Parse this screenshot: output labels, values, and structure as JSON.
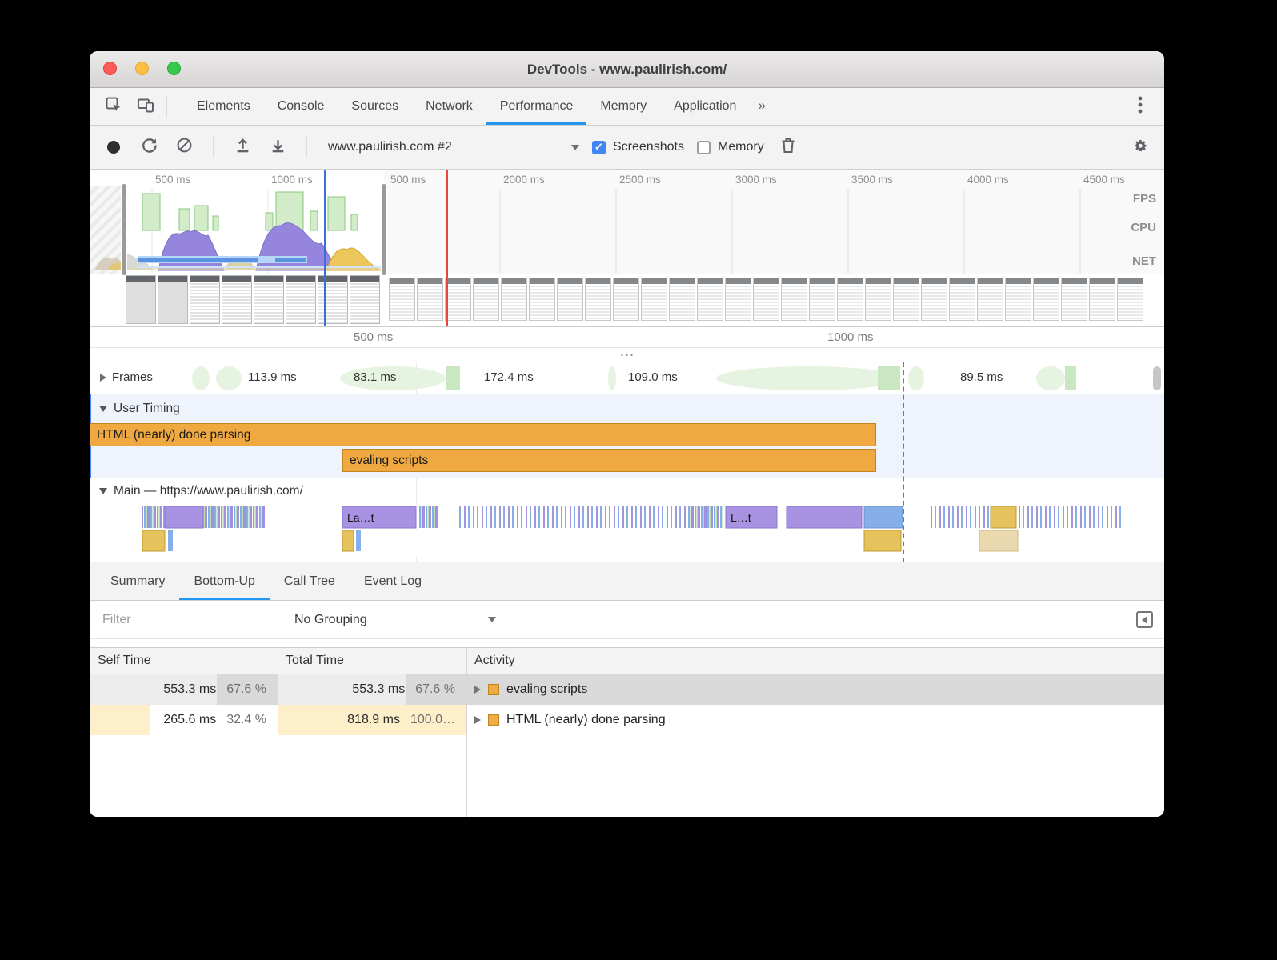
{
  "colors": {
    "accent_blue": "#2196F3",
    "checkbox_blue": "#4285F4",
    "timing_orange": "#F0A840",
    "frame_green": "#C9E7C0",
    "flame_purple": "#A893E3",
    "flame_blue": "#86AEE8",
    "flame_yellow": "#E6C25C"
  },
  "titlebar": {
    "title": "DevTools - www.paulirish.com/"
  },
  "panel_tabs": {
    "items": [
      "Elements",
      "Console",
      "Sources",
      "Network",
      "Performance",
      "Memory",
      "Application"
    ],
    "active": "Performance",
    "overflow": "»"
  },
  "perf_toolbar": {
    "session": "www.paulirish.com #2",
    "screenshots_label": "Screenshots",
    "memory_label": "Memory"
  },
  "overview": {
    "tick_labels": [
      "500 ms",
      "1000 ms",
      "500 ms",
      "2000 ms",
      "2500 ms",
      "3000 ms",
      "3500 ms",
      "4000 ms",
      "4500 ms"
    ],
    "lane_labels": {
      "fps": "FPS",
      "cpu": "CPU",
      "net": "NET"
    }
  },
  "ruler": {
    "t500": "500 ms",
    "t1000": "1000 ms"
  },
  "splitter": {
    "dots": "⋯"
  },
  "tracks": {
    "frames": {
      "label": "Frames",
      "durations": [
        "113.9 ms",
        "83.1 ms",
        "172.4 ms",
        "109.0 ms",
        "89.5 ms"
      ]
    },
    "user_timing": {
      "label": "User Timing",
      "bar_html": "HTML (nearly) done parsing",
      "bar_eval": "evaling scripts"
    },
    "main": {
      "label": "Main — https://www.paulirish.com/",
      "chip_layout": "La…t",
      "chip_layout2": "L…t"
    }
  },
  "bottom": {
    "tabs": [
      "Summary",
      "Bottom-Up",
      "Call Tree",
      "Event Log"
    ],
    "active_tab": "Bottom-Up",
    "filter_placeholder": "Filter",
    "grouping": "No Grouping",
    "table": {
      "headers": [
        "Self Time",
        "Total Time",
        "Activity"
      ],
      "rows": [
        {
          "self": "553.3 ms",
          "self_pct": "67.6 %",
          "total": "553.3 ms",
          "total_pct": "67.6 %",
          "activity": "evaling scripts"
        },
        {
          "self": "265.6 ms",
          "self_pct": "32.4 %",
          "total": "818.9 ms",
          "total_pct": "100.0…",
          "activity": "HTML (nearly) done parsing"
        }
      ]
    }
  }
}
